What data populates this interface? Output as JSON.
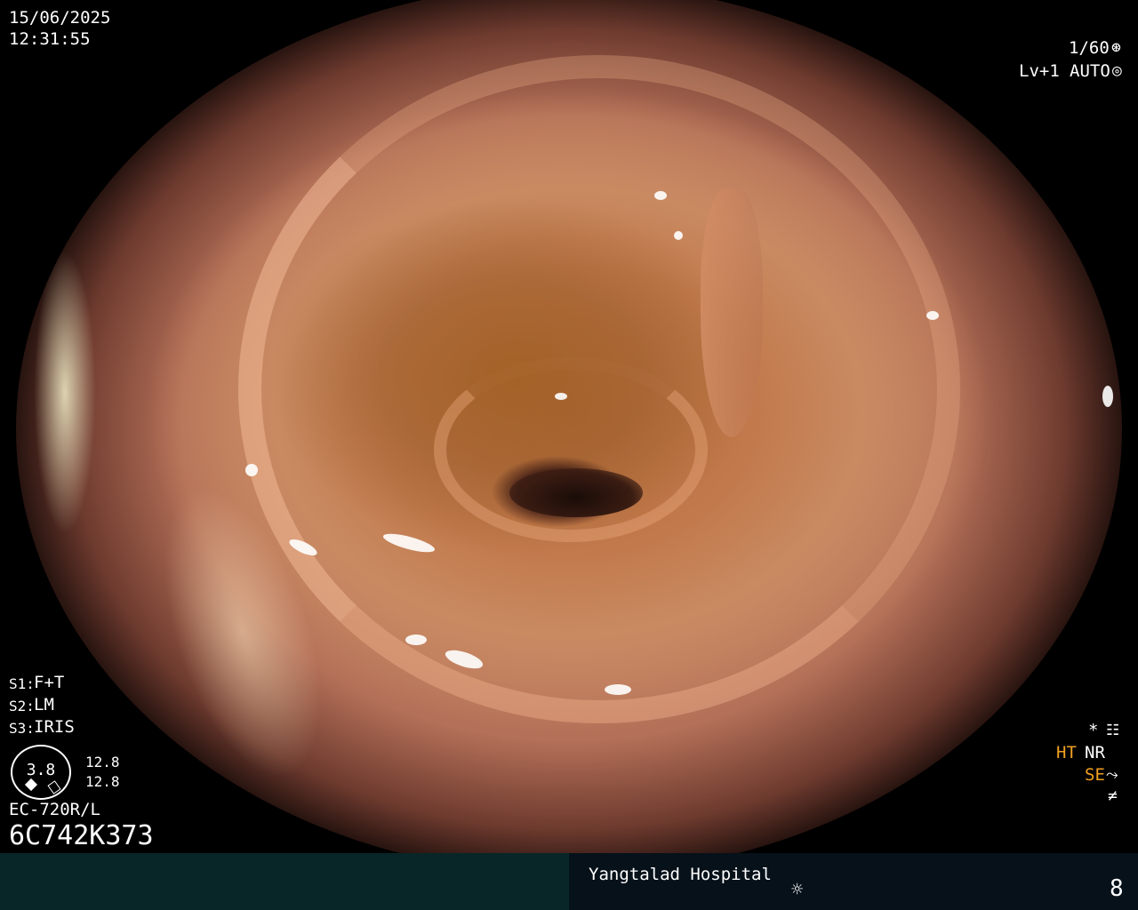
{
  "datetime": {
    "date": "15/06/2025",
    "time": "12:31:55"
  },
  "top_right": {
    "shutter": "1/60",
    "level": "Lv+1",
    "mode": "AUTO"
  },
  "scope_settings": {
    "s1_label": "S1:",
    "s1": "F+T",
    "s2_label": "S2:",
    "s2": "LM",
    "s3_label": "S3:",
    "s3": "IRIS"
  },
  "gauge": {
    "value": "3.8",
    "top_reading": "12.8",
    "bottom_reading": "12.8"
  },
  "device": {
    "model": "EC-720R/L",
    "serial": "6C742K373"
  },
  "right_panel": {
    "star": "*",
    "ht": "HT",
    "nr": "NR",
    "se": "SE"
  },
  "footer": {
    "hospital": "Yangtalad Hospital",
    "counter": "8"
  },
  "colors": {
    "amber": "#f0a020",
    "footer_left_bg": "#082628",
    "footer_right_bg": "#06111a"
  },
  "icons": [
    "shutter-icon",
    "auto-iris-icon",
    "settings-icon",
    "dial-icon",
    "flash-off-icon",
    "brightness-icon"
  ]
}
